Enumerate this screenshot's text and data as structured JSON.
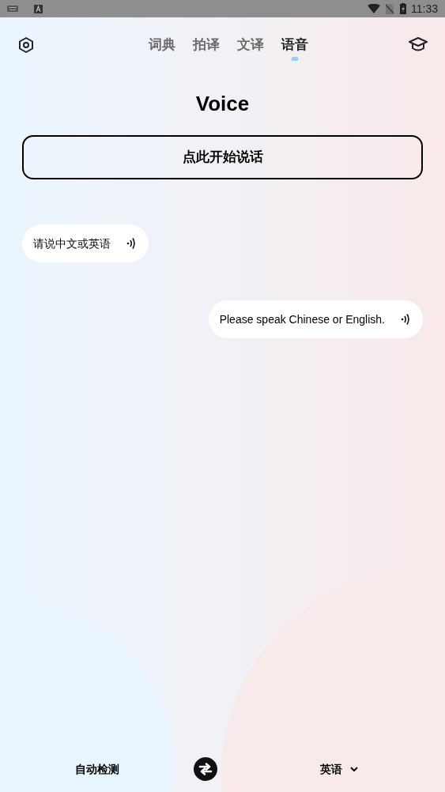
{
  "status_bar": {
    "time": "11:33"
  },
  "tabs": [
    {
      "label": "词典",
      "selected": false
    },
    {
      "label": "拍译",
      "selected": false
    },
    {
      "label": "文译",
      "selected": false
    },
    {
      "label": "语音",
      "selected": true
    }
  ],
  "title": "Voice",
  "speak_button": "点此开始说话",
  "messages": [
    {
      "kind": "source",
      "text": "请说中文或英语"
    },
    {
      "kind": "translation",
      "text": "Please speak Chinese or English."
    }
  ],
  "languages": {
    "source": "自动检测",
    "target": "英语"
  }
}
